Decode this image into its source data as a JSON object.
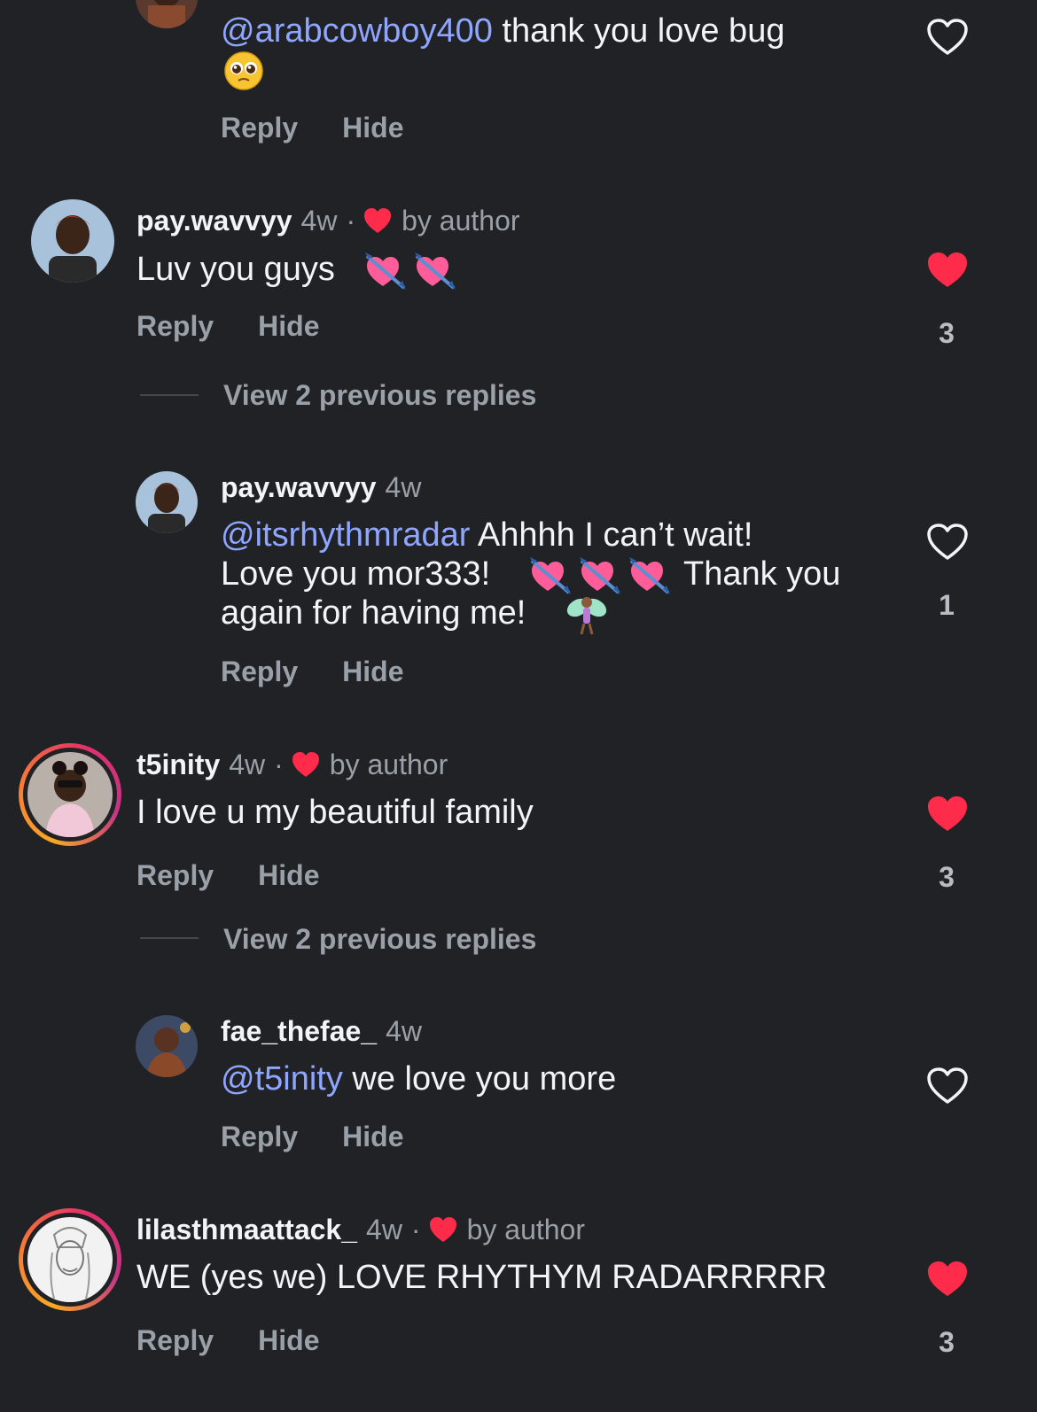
{
  "colors": {
    "background": "#212226",
    "text": "#f3f4f6",
    "muted": "#9aa0a8",
    "mention": "#8fa6ff",
    "like_red": "#ff2b4a"
  },
  "labels": {
    "reply": "Reply",
    "hide": "Hide",
    "by_author": "by author",
    "separator": "·"
  },
  "comments": [
    {
      "id": "c0",
      "username": "",
      "time": "",
      "mention": "@arabcowboy400",
      "text": " thank you love bug",
      "emojis": [
        "pleading-face-emoji"
      ],
      "liked": false,
      "like_count": ""
    },
    {
      "id": "c1",
      "username": "pay.wavvyy",
      "time": "4w",
      "liked_by_author": true,
      "text": "Luv you guys",
      "emojis": [
        "heart-with-arrow-emoji",
        "heart-with-arrow-emoji"
      ],
      "liked": true,
      "like_count": "3",
      "view_replies": "View 2 previous replies"
    },
    {
      "id": "c2",
      "username": "pay.wavvyy",
      "time": "4w",
      "mention": "@itsrhythmradar",
      "text_line1": " Ahhhh I can’t wait!",
      "text_line2a": "Love you mor333!",
      "text_line2b": "Thank you",
      "text_line3": "again for having me!",
      "emojis": [
        "heart-with-arrow-emoji",
        "heart-with-arrow-emoji",
        "heart-with-arrow-emoji",
        "fairy-emoji"
      ],
      "liked": false,
      "like_count": "1"
    },
    {
      "id": "c3",
      "username": "t5inity",
      "time": "4w",
      "liked_by_author": true,
      "text": "I love u my beautiful family",
      "liked": true,
      "like_count": "3",
      "view_replies": "View 2 previous replies"
    },
    {
      "id": "c4",
      "username": "fae_thefae_",
      "time": "4w",
      "mention": "@t5inity",
      "text": " we love you more",
      "liked": false,
      "like_count": ""
    },
    {
      "id": "c5",
      "username": "lilasthmaattack_",
      "time": "4w",
      "liked_by_author": true,
      "text": "WE (yes we) LOVE RHYTHYM RADARRRRR",
      "liked": true,
      "like_count": "3"
    }
  ]
}
